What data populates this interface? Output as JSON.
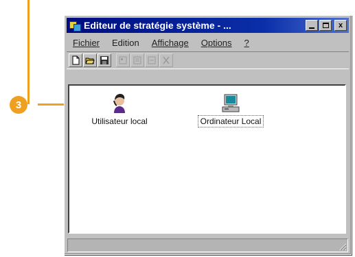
{
  "callout": {
    "number": "3"
  },
  "window": {
    "title": "Editeur de stratégie système - ...",
    "controls": {
      "minimize": "minimize",
      "maximize": "maximize",
      "close": "x"
    }
  },
  "menu": [
    {
      "label": "Fichier"
    },
    {
      "label": "Edition"
    },
    {
      "label": "Affichage"
    },
    {
      "label": "Options"
    },
    {
      "label": "?"
    }
  ],
  "toolbar": {
    "icons": [
      "new-icon",
      "open-icon",
      "save-icon",
      "properties-icon",
      "delete-icon",
      "copy-icon",
      "cut-icon"
    ]
  },
  "items": [
    {
      "label": "Utilisateur local",
      "icon": "user-icon"
    },
    {
      "label": "Ordinateur Local",
      "icon": "computer-icon",
      "selected": true
    }
  ],
  "colors": {
    "callout": "#f0a020",
    "titlebar": "#000c80"
  }
}
